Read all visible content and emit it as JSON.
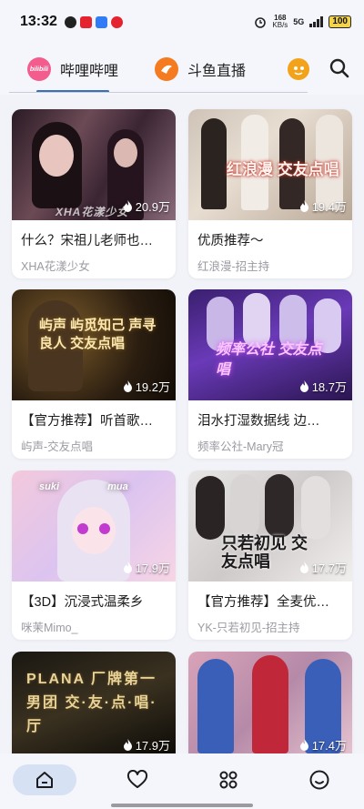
{
  "status_bar": {
    "time": "13:32",
    "net_speed_value": "168",
    "net_speed_unit": "KB/s",
    "network": "5G",
    "battery": "100"
  },
  "tabs": [
    {
      "label": "哔哩哔哩",
      "logo_text": "bilibili",
      "active": true
    },
    {
      "label": "斗鱼直播",
      "active": false
    }
  ],
  "cards": [
    {
      "title": "什么？宋祖儿老师也…",
      "subtitle": "XHA花漾少女",
      "views": "20.9万",
      "thumb_text": "XHA花漾少女"
    },
    {
      "title": "优质推荐～",
      "subtitle": "红浪漫-招主持",
      "views": "19.4万",
      "thumb_text": "红浪漫 交友点唱"
    },
    {
      "title": "【官方推荐】听首歌…",
      "subtitle": "屿声-交友点唱",
      "views": "19.2万",
      "thumb_text": "屿声 屿觅知己 声寻良人 交友点唱"
    },
    {
      "title": "泪水打湿数据线  边…",
      "subtitle": "频率公社-Mary冠",
      "views": "18.7万",
      "thumb_text": "频率公社 交友点唱"
    },
    {
      "title": "【3D】沉浸式温柔乡",
      "subtitle": "咪茉Mimo_",
      "views": "17.9万",
      "thumb_text": "suki mua"
    },
    {
      "title": "【官方推荐】全麦优…",
      "subtitle": "YK-只若初见-招主持",
      "views": "17.7万",
      "thumb_text": "只若初见 交友点唱"
    },
    {
      "title": "",
      "subtitle": "",
      "views": "17.9万",
      "thumb_text": "PLANA 厂牌第一男团 交·友·点·唱·厅"
    },
    {
      "title": "",
      "subtitle": "",
      "views": "17.4万",
      "thumb_text": ""
    }
  ],
  "nav": [
    {
      "icon": "home-icon",
      "active": true
    },
    {
      "icon": "heart-icon",
      "active": false
    },
    {
      "icon": "apps-icon",
      "active": false
    },
    {
      "icon": "smile-icon",
      "active": false
    }
  ]
}
